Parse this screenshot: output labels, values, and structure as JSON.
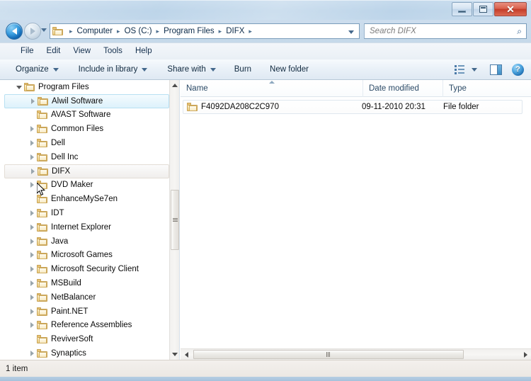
{
  "window": {
    "controls": {
      "minimize": "Minimize",
      "maximize": "Maximize",
      "close": "✕"
    }
  },
  "navbar": {
    "back_tooltip": "Back",
    "forward_tooltip": "Forward",
    "breadcrumbs": [
      "Computer",
      "OS (C:)",
      "Program Files",
      "DIFX"
    ],
    "refresh_glyph": "↻",
    "search": {
      "placeholder": "Search DIFX",
      "value": "",
      "icon_glyph": "⌕"
    }
  },
  "menubar": {
    "items": [
      "File",
      "Edit",
      "View",
      "Tools",
      "Help"
    ]
  },
  "toolbar": {
    "organize_label": "Organize",
    "include_label": "Include in library",
    "share_label": "Share with",
    "burn_label": "Burn",
    "new_folder_label": "New folder",
    "help_glyph": "?"
  },
  "tree": {
    "items": [
      {
        "label": "Program Files",
        "indent": 1,
        "state": "expanded",
        "row": "normal"
      },
      {
        "label": "Alwil Software",
        "indent": 2,
        "state": "collapsed",
        "row": "hover"
      },
      {
        "label": "AVAST Software",
        "indent": 2,
        "state": "none",
        "row": "normal"
      },
      {
        "label": "Common Files",
        "indent": 2,
        "state": "collapsed",
        "row": "normal"
      },
      {
        "label": "Dell",
        "indent": 2,
        "state": "collapsed",
        "row": "normal"
      },
      {
        "label": "Dell Inc",
        "indent": 2,
        "state": "collapsed",
        "row": "normal"
      },
      {
        "label": "DIFX",
        "indent": 2,
        "state": "collapsed",
        "row": "selected"
      },
      {
        "label": "DVD Maker",
        "indent": 2,
        "state": "collapsed",
        "row": "normal"
      },
      {
        "label": "EnhanceMySe7en",
        "indent": 2,
        "state": "none",
        "row": "normal"
      },
      {
        "label": "IDT",
        "indent": 2,
        "state": "collapsed",
        "row": "normal"
      },
      {
        "label": "Internet Explorer",
        "indent": 2,
        "state": "collapsed",
        "row": "normal"
      },
      {
        "label": "Java",
        "indent": 2,
        "state": "collapsed",
        "row": "normal"
      },
      {
        "label": "Microsoft Games",
        "indent": 2,
        "state": "collapsed",
        "row": "normal"
      },
      {
        "label": "Microsoft Security Client",
        "indent": 2,
        "state": "collapsed",
        "row": "normal"
      },
      {
        "label": "MSBuild",
        "indent": 2,
        "state": "collapsed",
        "row": "normal"
      },
      {
        "label": "NetBalancer",
        "indent": 2,
        "state": "collapsed",
        "row": "normal"
      },
      {
        "label": "Paint.NET",
        "indent": 2,
        "state": "collapsed",
        "row": "normal"
      },
      {
        "label": "Reference Assemblies",
        "indent": 2,
        "state": "collapsed",
        "row": "normal"
      },
      {
        "label": "ReviverSoft",
        "indent": 2,
        "state": "none",
        "row": "normal"
      },
      {
        "label": "Synaptics",
        "indent": 2,
        "state": "collapsed",
        "row": "normal"
      }
    ]
  },
  "filelist": {
    "columns": [
      {
        "label": "Name",
        "sorted": "asc"
      },
      {
        "label": "Date modified",
        "sorted": "none"
      },
      {
        "label": "Type",
        "sorted": "none"
      }
    ],
    "rows": [
      {
        "name": "F4092DA208C2C970",
        "date_modified": "09-11-2010 20:31",
        "type": "File folder"
      }
    ]
  },
  "statusbar": {
    "text": "1 item"
  }
}
